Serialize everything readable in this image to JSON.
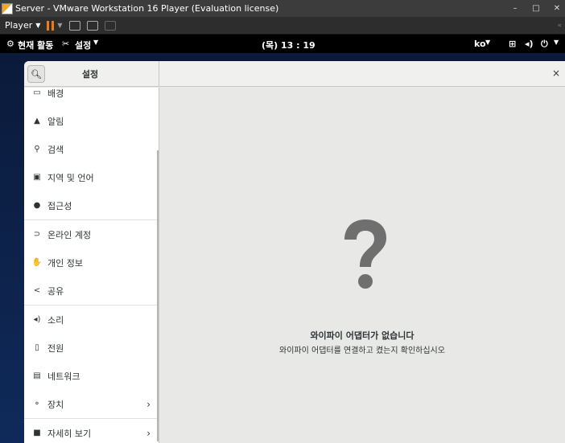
{
  "vmware": {
    "title": "Server - VMware Workstation 16 Player (Evaluation license)",
    "player_menu": "Player",
    "min": "–",
    "max": "□",
    "close": "✕"
  },
  "gnome": {
    "activities": "현재 활동",
    "settings_menu": "설정",
    "clock": "(목) 13 : 19",
    "lang": "ko"
  },
  "settings": {
    "title": "설정",
    "close": "×",
    "sidebar": [
      {
        "label": "배경",
        "icon": "background-icon"
      },
      {
        "label": "알림",
        "icon": "bell-icon"
      },
      {
        "label": "검색",
        "icon": "search-icon"
      },
      {
        "label": "지역 및 언어",
        "icon": "region-icon"
      },
      {
        "label": "접근성",
        "icon": "accessibility-icon"
      },
      {
        "label": "온라인 계정",
        "icon": "online-accounts-icon"
      },
      {
        "label": "개인 정보",
        "icon": "privacy-icon"
      },
      {
        "label": "공유",
        "icon": "share-icon"
      },
      {
        "label": "소리",
        "icon": "speaker-icon"
      },
      {
        "label": "전원",
        "icon": "power-icon"
      },
      {
        "label": "네트워크",
        "icon": "network-icon"
      },
      {
        "label": "장치",
        "icon": "devices-icon"
      },
      {
        "label": "자세히 보기",
        "icon": "details-icon"
      }
    ],
    "empty_title": "와이파이 어댑터가 없습니다",
    "empty_subtitle": "와이파이 어댑터를 연결하고 켰는지 확인하십시오"
  }
}
